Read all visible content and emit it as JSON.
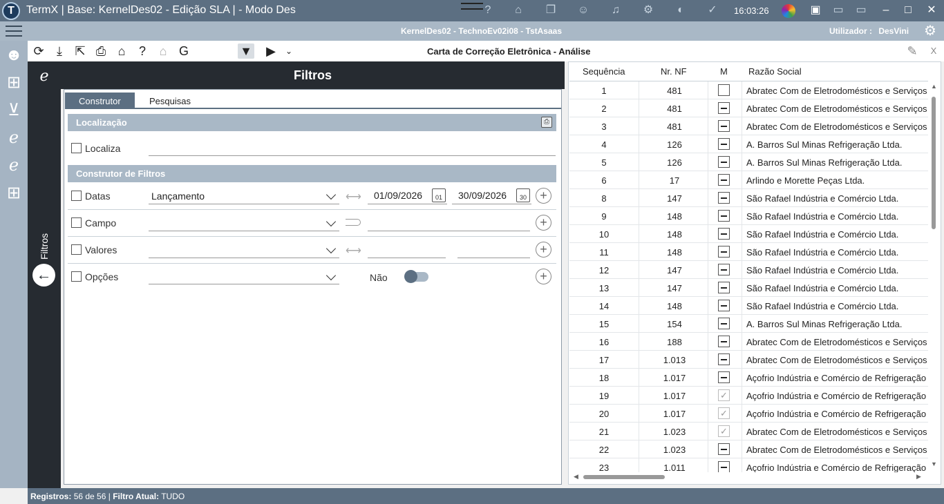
{
  "window": {
    "title": "TermX | Base: KernelDes02 - Edição SLA | - Modo Des",
    "clock": "16:03:26"
  },
  "header": {
    "context": "KernelDes02 - TechnoEv02i08 - TstAsaas",
    "user_label": "Utilizador :",
    "user_name": "DesVini"
  },
  "toolbar": {
    "form_title": "Carta de Correção Eletrônica - Análise",
    "close_label": "X"
  },
  "filters": {
    "header": "Filtros",
    "side_label": "Filtros",
    "tabs": [
      "Construtor",
      "Pesquisas"
    ],
    "location_section": "Localização",
    "locate_label": "Localiza",
    "builder_section": "Construtor de Filtros",
    "dates_label": "Datas",
    "dates_field": "Lançamento",
    "date_from": "01/09/2026",
    "date_to": "30/09/2026",
    "cal_from": "01",
    "cal_to": "30",
    "field_label": "Campo",
    "values_label": "Valores",
    "options_label": "Opções",
    "toggle_label": "Não"
  },
  "grid": {
    "columns": [
      "Sequência",
      "Nr. NF",
      "M",
      "Razão Social"
    ],
    "rows": [
      {
        "seq": "1",
        "nf": "481",
        "m": "empty",
        "razao": "Abratec Com de Eletrodomésticos e Serviços Ltda."
      },
      {
        "seq": "2",
        "nf": "481",
        "m": "dash",
        "razao": "Abratec Com de Eletrodomésticos e Serviços Ltda."
      },
      {
        "seq": "3",
        "nf": "481",
        "m": "dash",
        "razao": "Abratec Com de Eletrodomésticos e Serviços Ltda."
      },
      {
        "seq": "4",
        "nf": "126",
        "m": "dash",
        "razao": "A. Barros Sul Minas Refrigeração Ltda."
      },
      {
        "seq": "5",
        "nf": "126",
        "m": "dash",
        "razao": "A. Barros Sul Minas Refrigeração Ltda."
      },
      {
        "seq": "6",
        "nf": "17",
        "m": "dash",
        "razao": "Arlindo e Morette Peças Ltda."
      },
      {
        "seq": "8",
        "nf": "147",
        "m": "dash",
        "razao": "São Rafael Indústria e Comércio Ltda."
      },
      {
        "seq": "9",
        "nf": "148",
        "m": "dash",
        "razao": "São Rafael Indústria e Comércio Ltda."
      },
      {
        "seq": "10",
        "nf": "148",
        "m": "dash",
        "razao": "São Rafael Indústria e Comércio Ltda."
      },
      {
        "seq": "11",
        "nf": "148",
        "m": "dash",
        "razao": "São Rafael Indústria e Comércio Ltda."
      },
      {
        "seq": "12",
        "nf": "147",
        "m": "dash",
        "razao": "São Rafael Indústria e Comércio Ltda."
      },
      {
        "seq": "13",
        "nf": "147",
        "m": "dash",
        "razao": "São Rafael Indústria e Comércio Ltda."
      },
      {
        "seq": "14",
        "nf": "148",
        "m": "dash",
        "razao": "São Rafael Indústria e Comércio Ltda."
      },
      {
        "seq": "15",
        "nf": "154",
        "m": "dash",
        "razao": "A. Barros Sul Minas Refrigeração Ltda."
      },
      {
        "seq": "16",
        "nf": "188",
        "m": "dash",
        "razao": "Abratec Com de Eletrodomésticos e Serviços Ltda."
      },
      {
        "seq": "17",
        "nf": "1.013",
        "m": "dash",
        "razao": "Abratec Com de Eletrodomésticos e Serviços Ltda."
      },
      {
        "seq": "18",
        "nf": "1.017",
        "m": "dash",
        "razao": "Açofrio Indústria e Comércio de Refrigeração"
      },
      {
        "seq": "19",
        "nf": "1.017",
        "m": "check",
        "razao": "Açofrio Indústria e Comércio de Refrigeração"
      },
      {
        "seq": "20",
        "nf": "1.017",
        "m": "check",
        "razao": "Açofrio Indústria e Comércio de Refrigeração"
      },
      {
        "seq": "21",
        "nf": "1.023",
        "m": "check",
        "razao": "Abratec Com de Eletrodomésticos e Serviços Ltda."
      },
      {
        "seq": "22",
        "nf": "1.023",
        "m": "dash",
        "razao": "Abratec Com de Eletrodomésticos e Serviços Ltda."
      },
      {
        "seq": "23",
        "nf": "1.011",
        "m": "dash",
        "razao": "Açofrio Indústria e Comércio de Refrigeração"
      }
    ]
  },
  "status": {
    "records_label": "Registros:",
    "records_value": "56 de 56",
    "filter_label": "Filtro Atual:",
    "filter_value": "TUDO"
  }
}
